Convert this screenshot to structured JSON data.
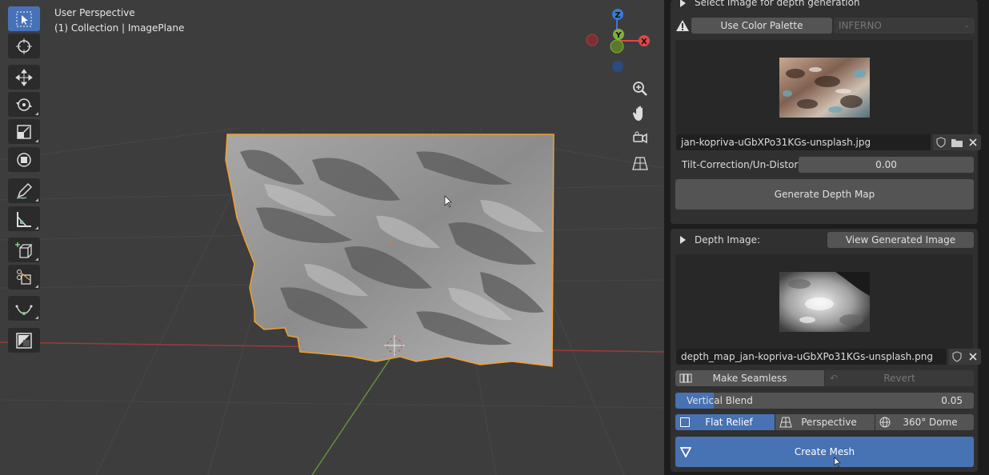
{
  "viewport": {
    "view_name": "User Perspective",
    "collection_label": "(1) Collection | ImagePlane",
    "gizmo": {
      "z": "Z",
      "y": "Y",
      "x": "X"
    },
    "tools": [
      {
        "name": "select-box-tool",
        "icon": "cursor-box-icon",
        "active": true
      },
      {
        "name": "cursor-tool",
        "icon": "crosshair-circle-icon",
        "active": false
      },
      {
        "name": "move-tool",
        "icon": "move-arrows-icon",
        "active": false
      },
      {
        "name": "rotate-tool",
        "icon": "rotate-icon",
        "active": false
      },
      {
        "name": "scale-tool",
        "icon": "scale-icon",
        "active": false
      },
      {
        "name": "transform-tool",
        "icon": "transform-icon",
        "active": false
      },
      {
        "name": "annotate-tool",
        "icon": "pencil-icon",
        "active": false
      },
      {
        "name": "measure-tool",
        "icon": "ruler-icon",
        "active": false
      },
      {
        "name": "add-cube-tool",
        "icon": "add-cube-icon",
        "active": false
      },
      {
        "name": "knife-tool",
        "icon": "knife-icon",
        "active": false
      },
      {
        "name": "curve-tool",
        "icon": "curve-icon",
        "active": false
      },
      {
        "name": "image-tool",
        "icon": "image-tool-icon",
        "active": false
      }
    ]
  },
  "panel": {
    "select_section": {
      "header": "Select Image for depth generation",
      "use_color_palette_label": "Use Color Palette",
      "palette_value": "INFERNO",
      "filename": "jan-kopriva-uGbXPo31KGs-unsplash.jpg",
      "tilt_label": "Tilt-Correction/Un-Distort",
      "tilt_value": "0.00",
      "generate_label": "Generate Depth Map"
    },
    "depth_section": {
      "header": "Depth Image:",
      "view_generated_label": "View Generated Image",
      "filename": "depth_map_jan-kopriva-uGbXPo31KGs-unsplash.png",
      "make_seamless_label": "Make Seamless",
      "revert_label": "Revert",
      "vertical_blend_label": "Vertical Blend",
      "vertical_blend_value": "0.05",
      "vertical_blend_fraction": 0.05,
      "modes": [
        "Flat Relief",
        "Perspective",
        "360° Dome"
      ],
      "active_mode": "Flat Relief",
      "create_mesh_label": "Create Mesh"
    }
  },
  "colors": {
    "accent": "#4772b3",
    "viewport_bg": "#3d3d3d",
    "selection_outline": "#f0a030",
    "axis_x": "#e04848",
    "axis_y": "#7fb03a",
    "axis_z": "#3a79d6"
  }
}
